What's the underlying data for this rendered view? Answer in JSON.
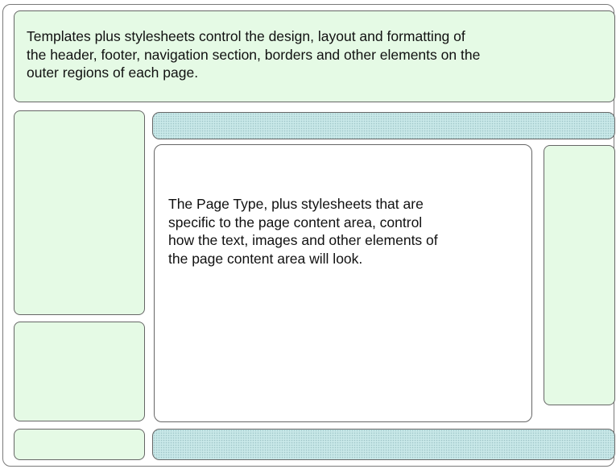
{
  "header": {
    "text": "Templates plus stylesheets control the design, layout and formatting of\nthe header, footer, navigation section, borders and other elements on the\nouter regions of each page."
  },
  "content": {
    "text": "The Page Type, plus stylesheets that are\nspecific to the page content area, control\nhow the text, images and other elements of\nthe page content area will look."
  },
  "colors": {
    "outer_region_fill": "#e5fae5",
    "navigation_bar_fill": "#c8e8e8",
    "content_fill": "#ffffff",
    "border": "#666666"
  }
}
